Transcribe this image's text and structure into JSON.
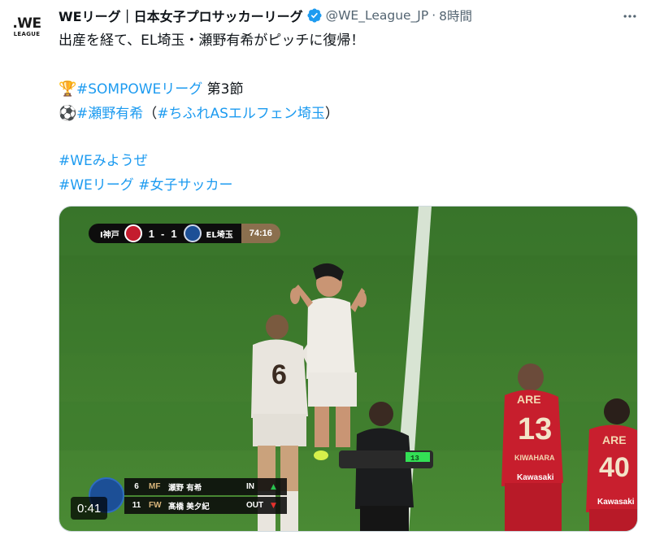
{
  "tweet": {
    "avatar": {
      "logo_main": ".WE",
      "logo_sub": "LEAGUE"
    },
    "author_name": "WEリーグ｜日本女子プロサッカーリーグ",
    "handle": "@WE_League_JP",
    "separator": "·",
    "time": "8時間",
    "more_icon": "more-horizontal-icon",
    "lines": {
      "l1": "出産を経て、EL埼玉・瀬野有希がピッチに復帰！",
      "l2_tag": "#SOMPOWEリーグ",
      "l2_text": " 第3節",
      "l3_tag1": "#瀬野有希",
      "l3_paren_open": "（",
      "l3_tag2": "#ちふれASエルフェン埼玉",
      "l3_paren_close": "）",
      "l4_tag": "#WEみようぜ",
      "l5_tag1": "#WEリーグ",
      "l5_space": " ",
      "l5_tag2": "#女子サッカー"
    },
    "emoji": {
      "trophy": "🏆",
      "ball": "⚽"
    }
  },
  "video": {
    "scorebug": {
      "home_team": "I神戸",
      "home_score": "1",
      "dash": "-",
      "away_score": "1",
      "away_team": "EL埼玉",
      "clock": "74:16"
    },
    "substitution": {
      "in_row": {
        "number": "6",
        "position": "MF",
        "name": "瀬野 有希",
        "direction": "IN",
        "arrow": "▲"
      },
      "out_row": {
        "number": "11",
        "position": "FW",
        "name": "髙橋 美夕紀",
        "direction": "OUT",
        "arrow": "▼"
      }
    },
    "player_numbers": {
      "left": "6",
      "right_front": "13",
      "right_back": "40"
    },
    "shirt_text": {
      "ARE": "ARE",
      "name1": "KIWAHARA",
      "kawasaki": "Kawasaki"
    },
    "elapsed": "0:41"
  },
  "colors": {
    "hashtag": "#1d9bf0",
    "verified": "#1d9bf0",
    "muted": "#536471",
    "pitch": "#3d7a2c",
    "kobe_red": "#c41c2e",
    "saitama_blue": "#1c4f96"
  }
}
